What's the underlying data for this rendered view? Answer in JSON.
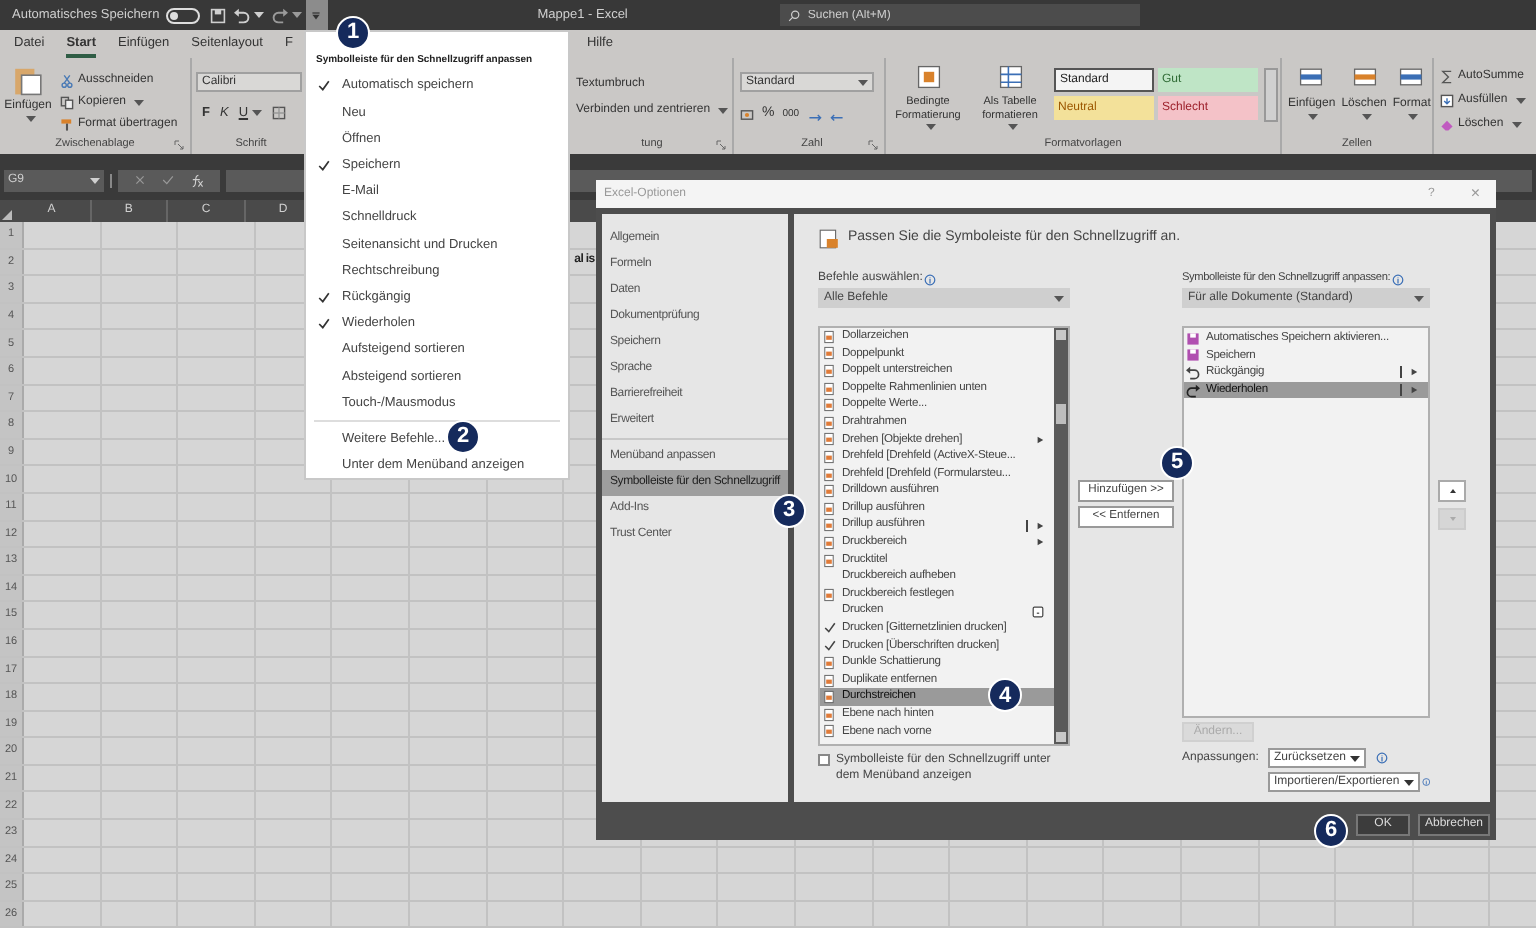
{
  "title_bar": {
    "autosave_label": "Automatisches Speichern",
    "autosave_on": false,
    "title": "Mappe1 - Excel",
    "search_placeholder": "Suchen (Alt+M)"
  },
  "ribbon_tabs": [
    {
      "label": "Datei",
      "selected": false
    },
    {
      "label": "Start",
      "selected": true
    },
    {
      "label": "Einfügen",
      "selected": false
    },
    {
      "label": "Seitenlayout",
      "selected": false
    },
    {
      "label": "F",
      "selected": false
    },
    {
      "label": "Hilfe",
      "selected": false
    }
  ],
  "ribbon": {
    "clipboard": {
      "paste": "Einfügen",
      "cut": "Ausschneiden",
      "copy": "Kopieren",
      "format_painter": "Format übertragen",
      "label": "Zwischenablage"
    },
    "font": {
      "font_name": "Calibri",
      "bold": "F",
      "italic": "K",
      "underline": "U",
      "label": "Schrift"
    },
    "alignment": {
      "wrap_text": "Textumbruch",
      "merge": "Verbinden und zentrieren",
      "label": "tung"
    },
    "number": {
      "format": "Standard",
      "percent": "%",
      "thousands": "000",
      "label": "Zahl"
    },
    "styles": {
      "conditional": "Bedingte Formatierung",
      "as_table": "Als Tabelle formatieren",
      "cells": [
        {
          "label": "Standard",
          "kind": "normal"
        },
        {
          "label": "Gut",
          "kind": "good"
        },
        {
          "label": "Neutral",
          "kind": "neutral"
        },
        {
          "label": "Schlecht",
          "kind": "bad"
        }
      ],
      "label": "Formatvorlagen"
    },
    "cells": {
      "insert": "Einfügen",
      "delete": "Löschen",
      "format": "Format",
      "label": "Zellen"
    },
    "editing": {
      "autosum": "AutoSumme",
      "fill": "Ausfüllen",
      "clear": "Löschen"
    }
  },
  "formula_bar": {
    "name_box": "G9"
  },
  "sheet": {
    "columns": [
      "A",
      "B",
      "C",
      "D"
    ],
    "rows": [
      "1",
      "2",
      "3",
      "4",
      "5",
      "6",
      "7",
      "8",
      "9",
      "10",
      "11",
      "12",
      "13",
      "14",
      "15",
      "16",
      "17",
      "18",
      "19",
      "20",
      "21",
      "22",
      "23",
      "24",
      "25",
      "26"
    ],
    "cell_text": "al is"
  },
  "qat_menu": {
    "callout": "1",
    "header": "Symbolleiste für den Schnellzugriff anpassen",
    "items": [
      {
        "label": "Automatisch speichern",
        "checked": true
      },
      {
        "label": "Neu",
        "checked": false
      },
      {
        "label": "Öffnen",
        "checked": false
      },
      {
        "label": "Speichern",
        "checked": true
      },
      {
        "label": "E-Mail",
        "checked": false
      },
      {
        "label": "Schnelldruck",
        "checked": false
      },
      {
        "label": "Seitenansicht und Drucken",
        "checked": false
      },
      {
        "label": "Rechtschreibung",
        "checked": false
      },
      {
        "label": "Rückgängig",
        "checked": true
      },
      {
        "label": "Wiederholen",
        "checked": true
      },
      {
        "label": "Aufsteigend sortieren",
        "checked": false
      },
      {
        "label": "Absteigend sortieren",
        "checked": false
      },
      {
        "label": "Touch-/Mausmodus",
        "checked": false
      }
    ],
    "more_commands": "Weitere Befehle...",
    "more_callout": "2",
    "below_ribbon": "Unter dem Menüband anzeigen"
  },
  "dialog": {
    "title": "Excel-Optionen",
    "help": "?",
    "close": "×",
    "nav": [
      {
        "label": "Allgemein",
        "selected": false
      },
      {
        "label": "Formeln",
        "selected": false
      },
      {
        "label": "Daten",
        "selected": false
      },
      {
        "label": "Dokumentprüfung",
        "selected": false
      },
      {
        "label": "Speichern",
        "selected": false
      },
      {
        "label": "Sprache",
        "selected": false
      },
      {
        "label": "Barrierefreiheit",
        "selected": false
      },
      {
        "label": "Erweitert",
        "selected": false
      },
      {
        "label": "Menüband anpassen",
        "selected": false
      },
      {
        "label": "Symbolleiste für den Schnellzugriff",
        "selected": true,
        "callout": "3"
      },
      {
        "label": "Add-Ins",
        "selected": false
      },
      {
        "label": "Trust Center",
        "selected": false
      }
    ],
    "heading": "Passen Sie die Symboleiste für den Schnellzugriff an.",
    "commands_label": "Befehle auswählen:",
    "commands_choice": "Alle Befehle",
    "commands": [
      {
        "label": "Dollarzeichen",
        "kind": "icon",
        "selected": false,
        "submenu": false,
        "split": false,
        "options_box": false
      },
      {
        "label": "Doppelpunkt",
        "kind": "icon",
        "selected": false,
        "submenu": false,
        "split": false,
        "options_box": false
      },
      {
        "label": "Doppelt unterstreichen",
        "kind": "icon",
        "selected": false,
        "submenu": false,
        "split": false,
        "options_box": false
      },
      {
        "label": "Doppelte Rahmenlinien unten",
        "kind": "icon",
        "selected": false,
        "submenu": false,
        "split": false,
        "options_box": false
      },
      {
        "label": "Doppelte Werte...",
        "kind": "icon",
        "selected": false,
        "submenu": false,
        "split": false,
        "options_box": false
      },
      {
        "label": "Drahtrahmen",
        "kind": "icon",
        "selected": false,
        "submenu": false,
        "split": false,
        "options_box": false
      },
      {
        "label": "Drehen [Objekte drehen]",
        "kind": "icon",
        "selected": false,
        "submenu": true,
        "split": false,
        "options_box": false
      },
      {
        "label": "Drehfeld [Drehfeld (ActiveX-Steue...",
        "kind": "icon",
        "selected": false,
        "submenu": false,
        "split": false,
        "options_box": false
      },
      {
        "label": "Drehfeld [Drehfeld (Formularsteu...",
        "kind": "icon",
        "selected": false,
        "submenu": false,
        "split": false,
        "options_box": false
      },
      {
        "label": "Drilldown ausführen",
        "kind": "icon",
        "selected": false,
        "submenu": false,
        "split": false,
        "options_box": false
      },
      {
        "label": "Drillup ausführen",
        "kind": "icon",
        "selected": false,
        "submenu": false,
        "split": false,
        "options_box": false
      },
      {
        "label": "Drillup ausführen",
        "kind": "icon",
        "selected": false,
        "submenu": true,
        "split": true,
        "options_box": false
      },
      {
        "label": "Druckbereich",
        "kind": "icon",
        "selected": false,
        "submenu": true,
        "split": false,
        "options_box": false
      },
      {
        "label": "Drucktitel",
        "kind": "icon",
        "selected": false,
        "submenu": false,
        "split": false,
        "options_box": false
      },
      {
        "label": "Druckbereich aufheben",
        "kind": "plain",
        "selected": false,
        "submenu": false,
        "split": false,
        "options_box": false
      },
      {
        "label": "Druckbereich festlegen",
        "kind": "icon",
        "selected": false,
        "submenu": false,
        "split": false,
        "options_box": false
      },
      {
        "label": "Drucken",
        "kind": "plain",
        "selected": false,
        "submenu": false,
        "split": false,
        "options_box": true
      },
      {
        "label": "Drucken [Gitternetzlinien drucken]",
        "kind": "check",
        "selected": false,
        "submenu": false,
        "split": false,
        "options_box": false
      },
      {
        "label": "Drucken [Überschriften drucken]",
        "kind": "check",
        "selected": false,
        "submenu": false,
        "split": false,
        "options_box": false
      },
      {
        "label": "Dunkle Schattierung",
        "kind": "icon",
        "selected": false,
        "submenu": false,
        "split": false,
        "options_box": false
      },
      {
        "label": "Duplikate entfernen",
        "kind": "icon",
        "selected": false,
        "submenu": false,
        "split": false,
        "options_box": false
      },
      {
        "label": "Durchstreichen",
        "kind": "icon",
        "selected": true,
        "submenu": false,
        "split": false,
        "options_box": false,
        "callout": "4"
      },
      {
        "label": "Ebene nach hinten",
        "kind": "icon",
        "selected": false,
        "submenu": false,
        "split": false,
        "options_box": false
      },
      {
        "label": "Ebene nach vorne",
        "kind": "icon",
        "selected": false,
        "submenu": false,
        "split": false,
        "options_box": false
      }
    ],
    "show_below": {
      "label": "Symbolleiste für den Schnellzugriff unter dem Menüband anzeigen",
      "checked": false
    },
    "add": "Hinzufügen >>",
    "add_callout": "5",
    "remove": "<< Entfernen",
    "toolbar_label": "Symbolleiste für den Schnellzugriff anpassen:",
    "toolbar_choice": "Für alle Dokumente (Standard)",
    "toolbar": [
      {
        "label": "Automatisches Speichern aktivieren...",
        "kind": "save",
        "selected": false,
        "submenu": false,
        "split": false,
        "options_box": false
      },
      {
        "label": "Speichern",
        "kind": "save",
        "selected": false,
        "submenu": false,
        "split": false,
        "options_box": false
      },
      {
        "label": "Rückgängig",
        "kind": "undo",
        "selected": false,
        "submenu": true,
        "split": true,
        "options_box": false
      },
      {
        "label": "Wiederholen",
        "kind": "redo",
        "selected": true,
        "submenu": true,
        "split": true,
        "options_box": false
      }
    ],
    "modify": {
      "label": "Ändern...",
      "disabled": true
    },
    "customizations_label": "Anpassungen:",
    "reset": "Zurücksetzen",
    "import_export": "Importieren/Exportieren",
    "ok": "OK",
    "ok_callout": "6",
    "cancel": "Abbrechen"
  }
}
